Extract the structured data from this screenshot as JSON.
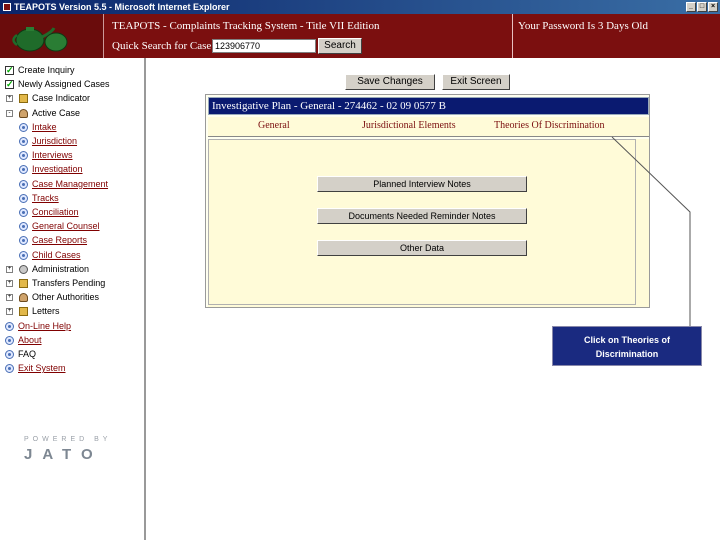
{
  "window": {
    "title": "TEAPOTS Version 5.5 - Microsoft Internet Explorer",
    "controls": [
      "_",
      "□",
      "×"
    ]
  },
  "header": {
    "title": "TEAPOTS - Complaints Tracking System - Title VII Edition",
    "quick_search_label": "Quick Search for Case",
    "quick_search_value": "123906770",
    "search_button": "Search",
    "password_notice": "Your Password Is 3 Days Old"
  },
  "sidebar": {
    "items": [
      {
        "label": "Create Inquiry",
        "icon": "check-icon",
        "link": false
      },
      {
        "label": "Newly Assigned Cases",
        "icon": "check-icon",
        "link": false
      },
      {
        "label": "Case Indicator",
        "icon": "folder-icon",
        "link": false,
        "expander": "+"
      },
      {
        "label": "Active Case",
        "icon": "people-icon",
        "link": false,
        "expander": "-"
      },
      {
        "label": "Intake",
        "icon": "doc-icon",
        "link": true
      },
      {
        "label": "Jurisdiction",
        "icon": "doc-icon",
        "link": true
      },
      {
        "label": "Interviews",
        "icon": "doc-icon",
        "link": true
      },
      {
        "label": "Investigation",
        "icon": "doc-icon",
        "link": true
      },
      {
        "label": "Case Management",
        "icon": "doc-icon",
        "link": true
      },
      {
        "label": "Tracks",
        "icon": "doc-icon",
        "link": true
      },
      {
        "label": "Conciliation",
        "icon": "doc-icon",
        "link": true
      },
      {
        "label": "General Counsel",
        "icon": "doc-icon",
        "link": true
      },
      {
        "label": "Case Reports",
        "icon": "doc-icon",
        "link": true
      },
      {
        "label": "Child Cases",
        "icon": "doc-icon",
        "link": true
      },
      {
        "label": "Administration",
        "icon": "gear-icon",
        "link": false,
        "expander": "+"
      },
      {
        "label": "Transfers Pending",
        "icon": "folder-icon",
        "link": false,
        "expander": "+"
      },
      {
        "label": "Other Authorities",
        "icon": "people-icon",
        "link": false,
        "expander": "+"
      },
      {
        "label": "Letters",
        "icon": "folder-icon",
        "link": false,
        "expander": "+"
      },
      {
        "label": "On-Line Help",
        "icon": "doc-icon",
        "link": true
      },
      {
        "label": "About",
        "icon": "doc-icon",
        "link": true
      },
      {
        "label": "FAQ",
        "icon": "doc-icon",
        "link": false
      },
      {
        "label": "Exit System",
        "icon": "doc-icon",
        "link": true
      }
    ],
    "powered_by": "POWERED BY",
    "brand": "JATO"
  },
  "main": {
    "save_button": "Save Changes",
    "exit_button": "Exit Screen",
    "plan_header": "Investigative Plan - General - 274462 - 02 09 0577 B",
    "tabs": [
      "General",
      "Jurisdictional Elements",
      "Theories Of Discrimination"
    ],
    "actions": [
      "Planned Interview Notes",
      "Documents Needed Reminder Notes",
      "Other Data"
    ]
  },
  "callout": {
    "text": "Click on Theories of Discrimination"
  },
  "colors": {
    "brand": "#7b0f0f",
    "plan_header": "#0a1a70",
    "panel": "#fffbd8",
    "callout": "#1a2a80"
  }
}
